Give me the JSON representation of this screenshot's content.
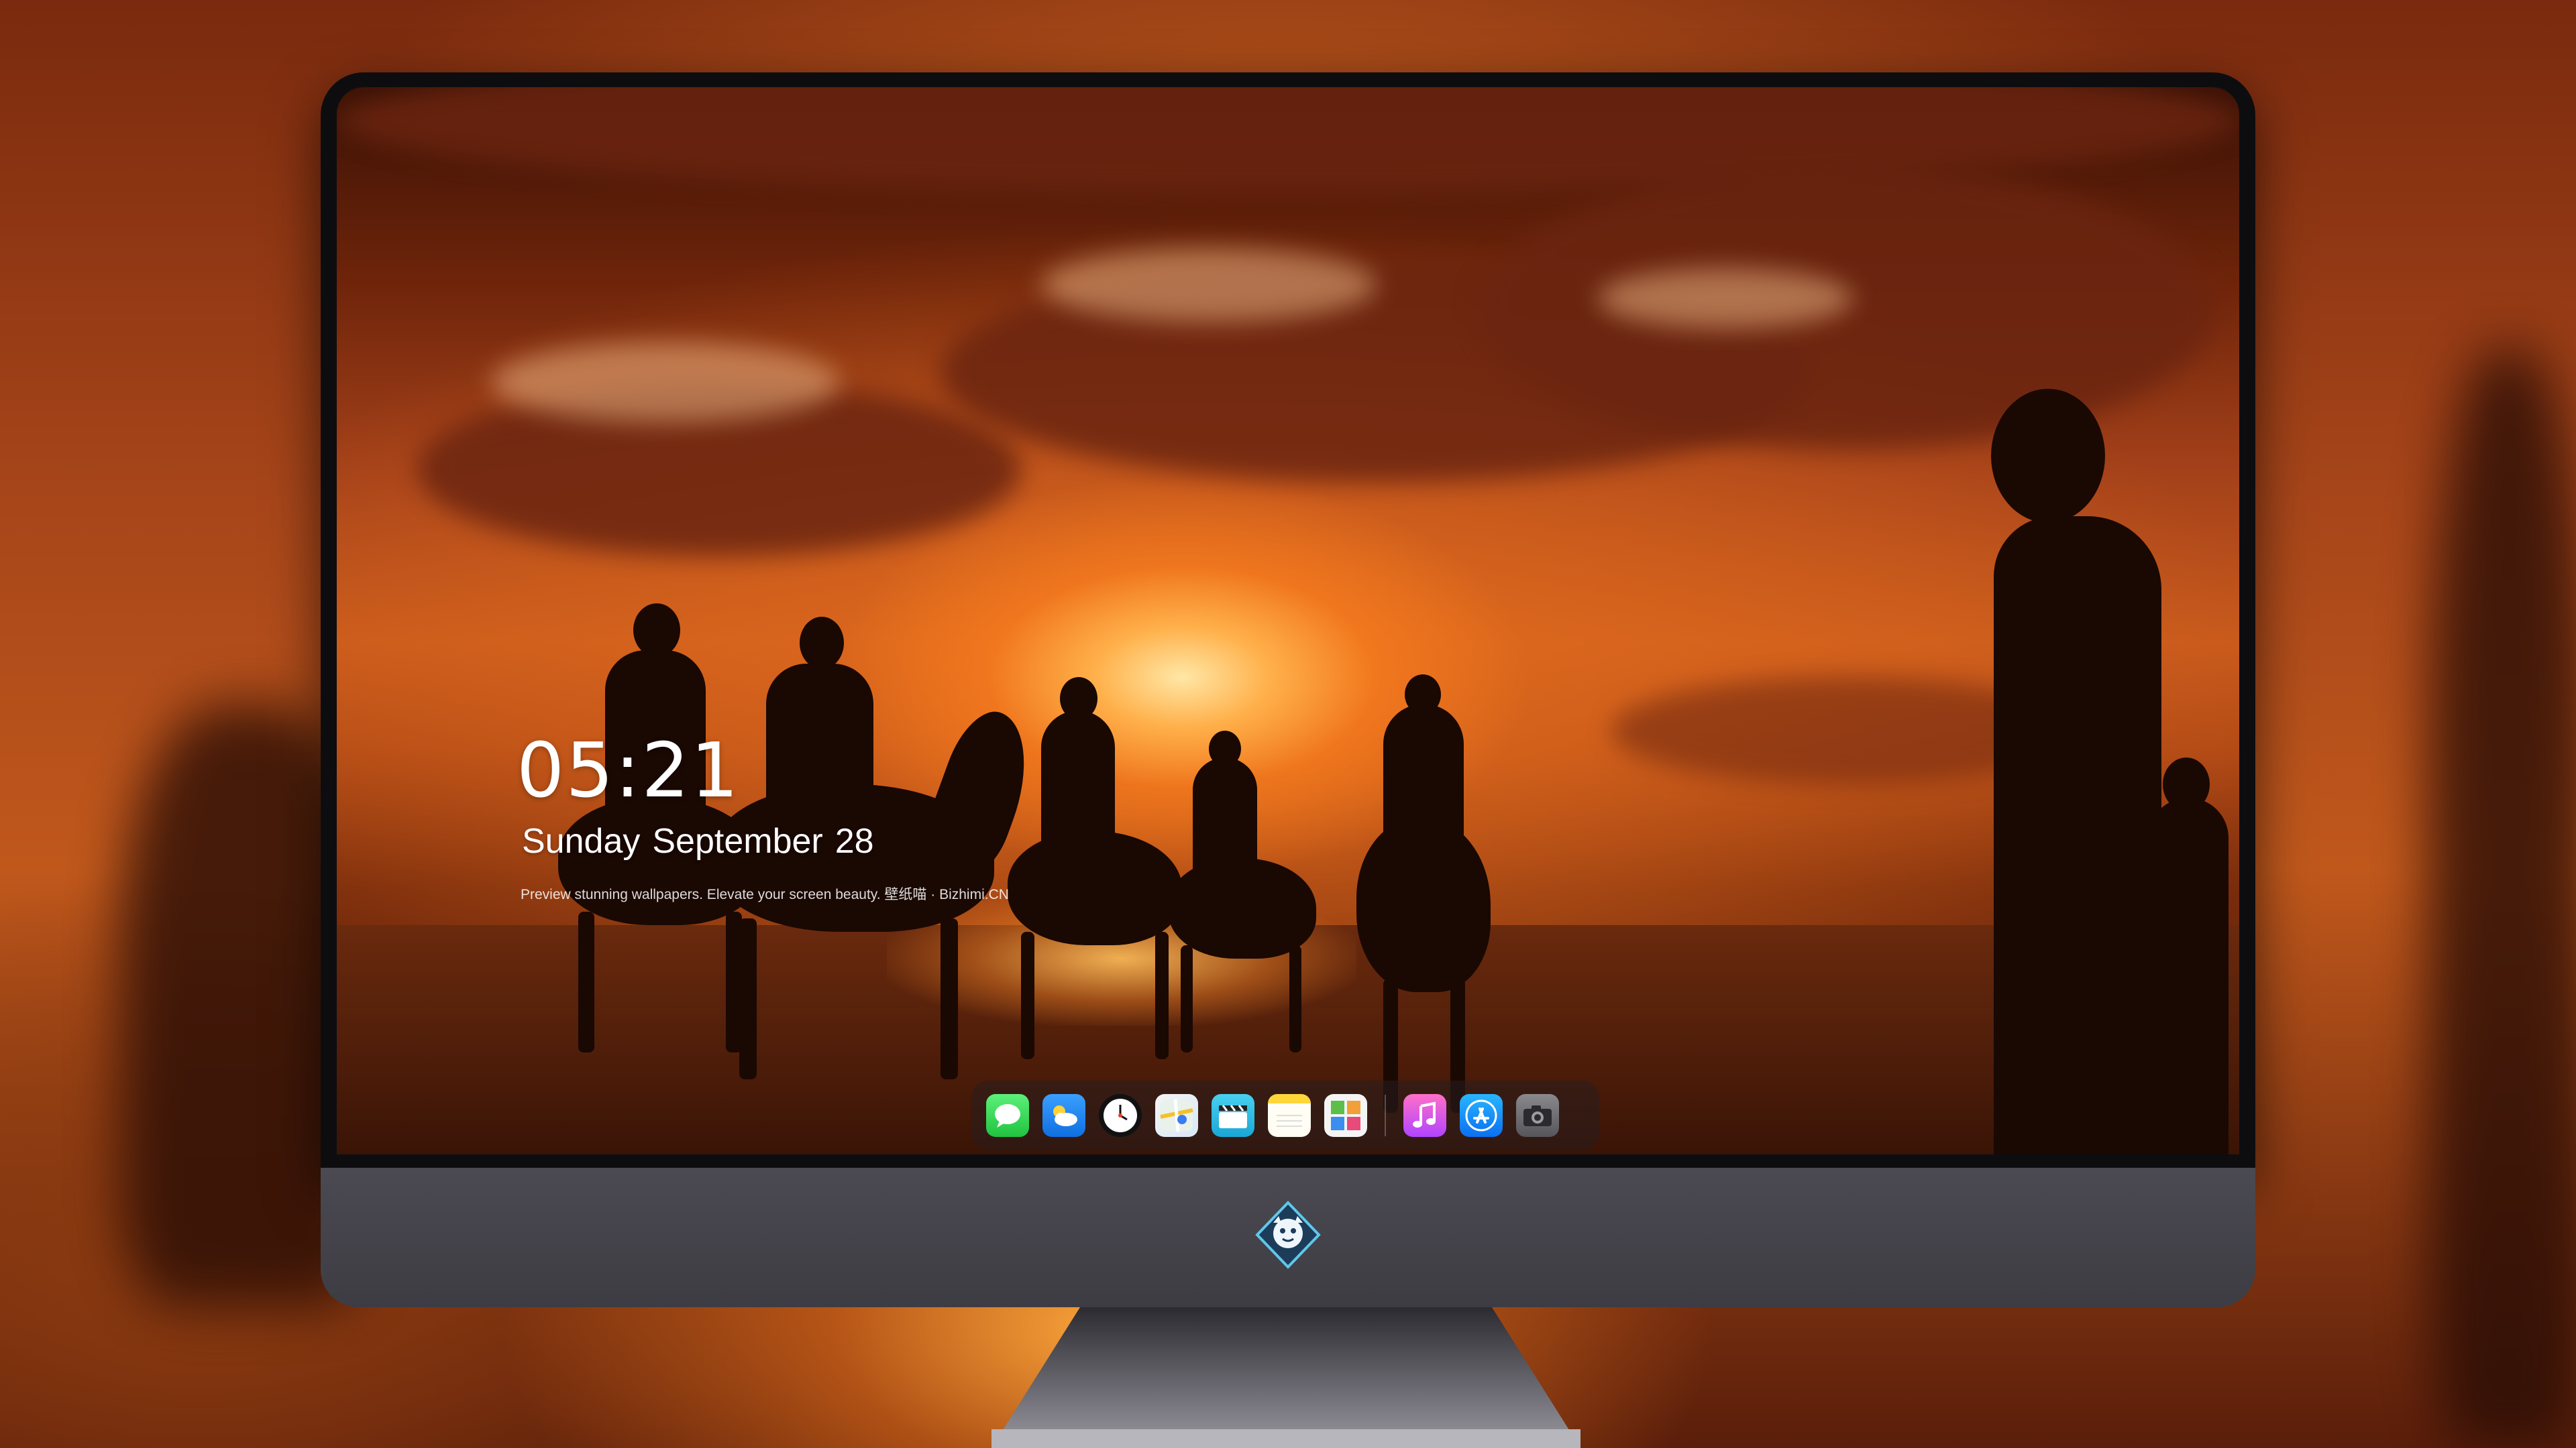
{
  "lock_screen": {
    "time": "05:21",
    "weekday": "Sunday",
    "month": "September",
    "day": "28",
    "tagline": "Preview stunning wallpapers. Elevate your screen beauty. 壁纸喵 · Bizhimi.CN"
  },
  "dock": {
    "apps": [
      {
        "name": "Messages",
        "icon": "message-bubble-icon"
      },
      {
        "name": "Weather",
        "icon": "cloud-sun-icon"
      },
      {
        "name": "Clock",
        "icon": "clock-icon"
      },
      {
        "name": "Maps",
        "icon": "map-icon"
      },
      {
        "name": "Clips",
        "icon": "clapperboard-icon"
      },
      {
        "name": "Notes",
        "icon": "notes-icon"
      },
      {
        "name": "Photos",
        "icon": "photo-grid-icon"
      },
      {
        "name": "Music",
        "icon": "music-note-icon"
      },
      {
        "name": "App Store",
        "icon": "app-store-icon"
      },
      {
        "name": "Camera",
        "icon": "camera-icon"
      }
    ]
  },
  "colors": {
    "sky_top": "#3b1206",
    "sun_glow": "#ffe7a6",
    "monitor_bezel": "#0d0d10",
    "monitor_chin": "#4b4a52"
  }
}
